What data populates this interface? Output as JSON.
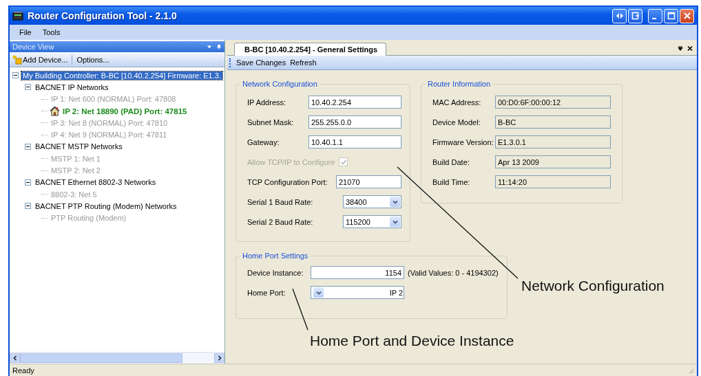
{
  "window": {
    "title": "Router Configuration Tool - 2.1.0"
  },
  "menu": [
    "File",
    "Tools"
  ],
  "device_view": {
    "title": "Device View",
    "toolbar": [
      "Add Device...",
      "Options..."
    ],
    "tree": [
      {
        "label": "My Building Controller: B-BC [10.40.2.254] Firmware: E1.3.",
        "selected": true,
        "expanded": true,
        "children": [
          {
            "label": "BACNET IP Networks",
            "selected": false,
            "expanded": true,
            "children": [
              {
                "label": "IP 1: Net 600 (NORMAL) Port: 47808",
                "selected": false,
                "home": false
              },
              {
                "label": "IP 2: Net 18890 (PAD) Port: 47815",
                "selected": false,
                "home": true
              },
              {
                "label": "IP 3: Net 8 (NORMAL) Port: 47810",
                "selected": false,
                "home": false
              },
              {
                "label": "IP 4: Net 9 (NORMAL) Port: 47811",
                "selected": false,
                "home": false
              }
            ]
          },
          {
            "label": "BACNET MSTP Networks",
            "selected": false,
            "expanded": true,
            "children": [
              {
                "label": "MSTP 1: Net 1",
                "selected": false,
                "home": false
              },
              {
                "label": "MSTP 2: Net 2",
                "selected": false,
                "home": false
              }
            ]
          },
          {
            "label": "BACNET Ethernet 8802-3 Networks",
            "selected": false,
            "expanded": true,
            "children": [
              {
                "label": "8802-3: Net 5",
                "selected": false,
                "home": false
              }
            ]
          },
          {
            "label": "BACNET PTP Routing (Modem) Networks",
            "selected": false,
            "expanded": true,
            "children": [
              {
                "label": "PTP Routing (Modem)",
                "selected": false,
                "home": false
              }
            ]
          }
        ]
      }
    ]
  },
  "document": {
    "tab": {
      "label": "B-BC [10.40.2.254] - General Settings",
      "selected": true
    },
    "toolbar": [
      "Save Changes",
      "Refresh"
    ],
    "network_configuration": {
      "title": "Network Configuration",
      "fields": [
        {
          "kind": "text",
          "label": "IP Address:",
          "value": "10.40.2.254"
        },
        {
          "kind": "text",
          "label": "Subnet Mask:",
          "value": "255.255.0.0"
        },
        {
          "kind": "text",
          "label": "Gateway:",
          "value": "10.40.1.1"
        },
        {
          "kind": "checkbox",
          "label": "Allow TCP/IP to Configure",
          "checked": true,
          "disabled": true
        },
        {
          "kind": "text",
          "label": "TCP Configuration Port:",
          "value": "21070"
        },
        {
          "kind": "combo",
          "label": "Serial 1 Baud Rate:",
          "value": "38400"
        },
        {
          "kind": "combo",
          "label": "Serial 2 Baud Rate:",
          "value": "115200"
        }
      ]
    },
    "router_information": {
      "title": "Router Information",
      "fields": [
        {
          "label": "MAC Address:",
          "value": "00:D0:6F:00:00:12"
        },
        {
          "label": "Device Model:",
          "value": "B-BC"
        },
        {
          "label": "Firmware Version:",
          "value": "E1.3.0.1"
        },
        {
          "label": "Build Date:",
          "value": "Apr 13 2009"
        },
        {
          "label": "Build Time:",
          "value": "11:14:20"
        }
      ]
    },
    "home_port_settings": {
      "title": "Home Port Settings",
      "fields": [
        {
          "kind": "number",
          "label": "Device Instance:",
          "value": "1154",
          "note": "(Valid Values: 0 - 4194302)"
        },
        {
          "kind": "combo-rtl",
          "label": "Home Port:",
          "value": "IP 2"
        }
      ]
    }
  },
  "status_bar": "Ready",
  "callouts": [
    "Network Configuration",
    "Home Port and Device Instance"
  ]
}
